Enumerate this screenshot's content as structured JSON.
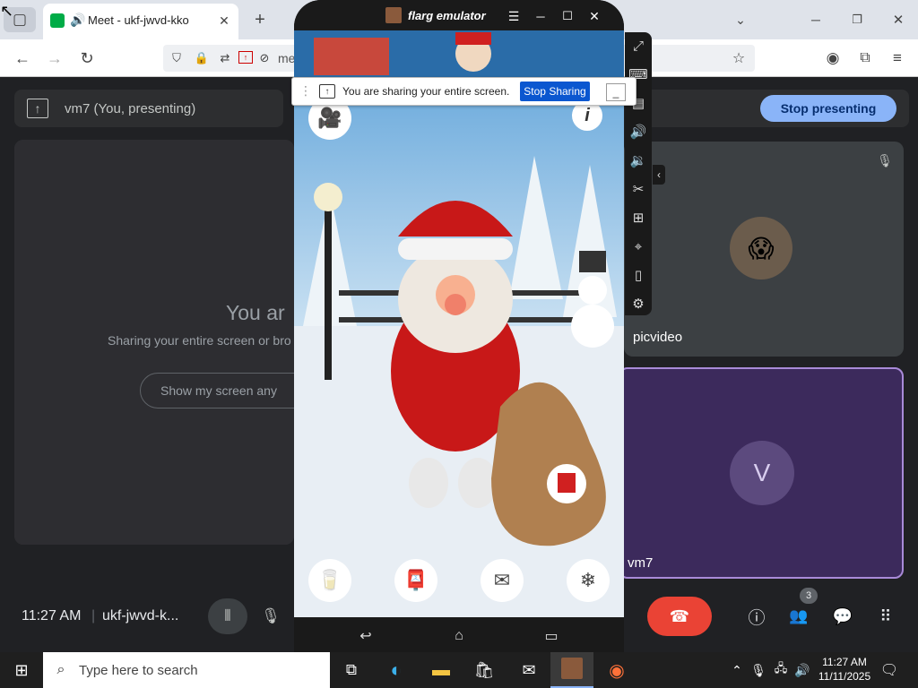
{
  "browser": {
    "tab_title": "Meet - ukf-jwvd-kko",
    "url_partial": "me"
  },
  "meet": {
    "presenter_banner": "vm7 (You, presenting)",
    "stop_presenting": "Stop presenting",
    "you_are_text": "You ar",
    "sharing_text": "Sharing your entire screen or bro",
    "show_screen_btn": "Show my screen any",
    "tile_label_1": "picvideo",
    "tile_label_2": "vm7",
    "avatar_letter": "V",
    "time": "11:27 AM",
    "meeting_code": "ukf-jwvd-k...",
    "participants_count": "3"
  },
  "emulator": {
    "title": "flarg emulator"
  },
  "share_bar": {
    "message": "You are sharing your entire screen.",
    "stop_label": "Stop Sharing"
  },
  "taskbar": {
    "search_placeholder": "Type here to search",
    "clock_time": "11:27 AM",
    "clock_date": "11/11/2025"
  },
  "colors": {
    "meet_bg": "#202124",
    "meet_accent": "#8ab4f8",
    "end_call_red": "#ea4335",
    "share_blue": "#0b57d0",
    "tile_purple": "#3c2a5c"
  }
}
